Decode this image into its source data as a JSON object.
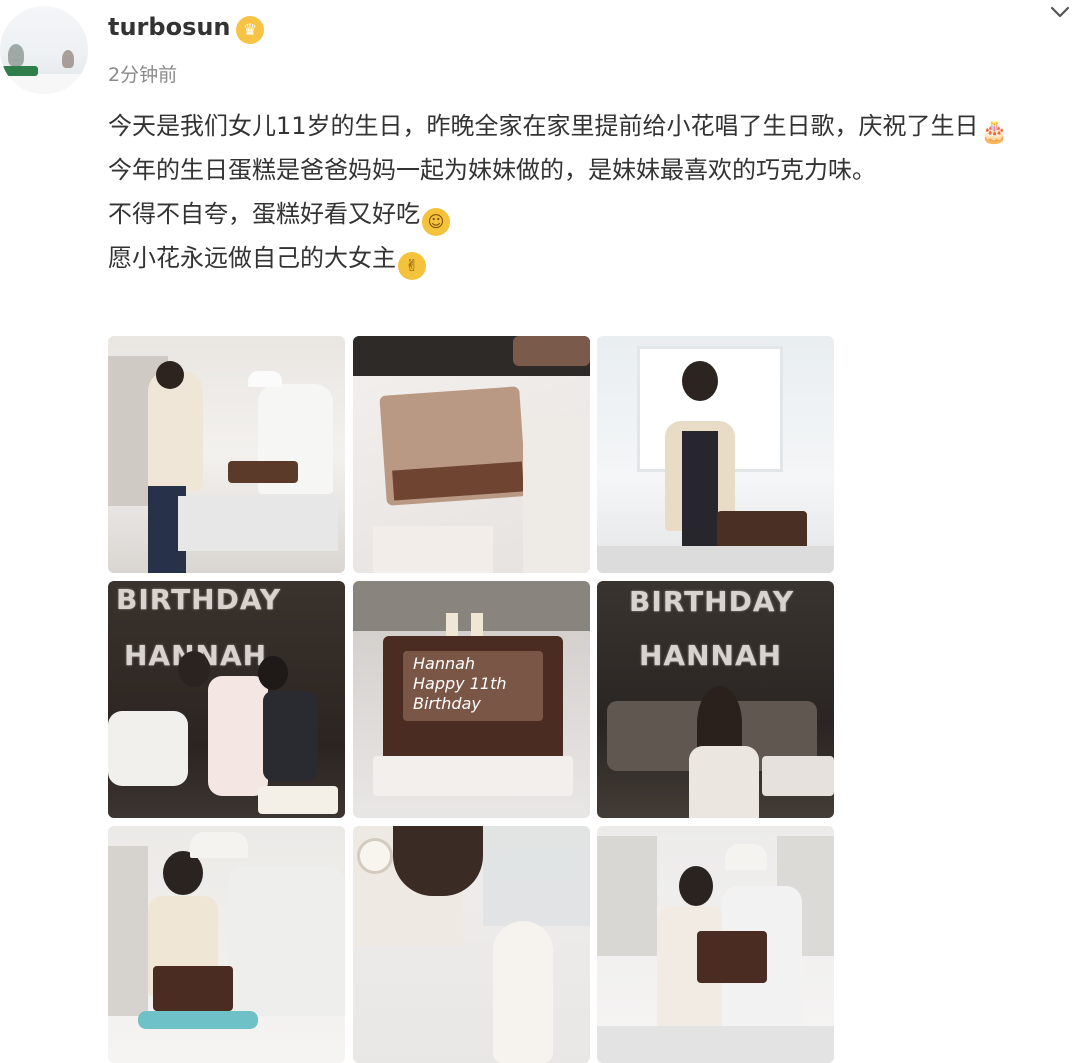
{
  "post": {
    "username": "turbosun",
    "time": "2分钟前",
    "lines": [
      "今天是我们女儿11岁的生日，昨晚全家在家里提前给小花唱了生日歌，庆祝了生日",
      "今年的生日蛋糕是爸爸妈妈一起为妹妹做的，是妹妹最喜欢的巧克力味。",
      "不得不自夸，蛋糕好看又好吃",
      "愿小花永远做自己的大女主"
    ],
    "icons": {
      "badge": "crown-badge-icon",
      "menu": "chevron-down-icon",
      "line1": "birthday-cake-icon",
      "line3": "proud-face-icon",
      "line4": "victory-hand-icon"
    }
  },
  "photos": [
    {
      "name": "baking-couple-photo"
    },
    {
      "name": "frosting-cake-photo"
    },
    {
      "name": "girl-with-cake-photo"
    },
    {
      "name": "birthday-kiss-photo",
      "banner_top": "BIRTHDAY",
      "banner_bottom": "HANNAH"
    },
    {
      "name": "birthday-cake-photo",
      "cake_text": [
        "Hannah",
        "Happy 11th",
        "Birthday"
      ]
    },
    {
      "name": "birthday-girl-photo",
      "banner_top": "BIRTHDAY",
      "banner_bottom": "HANNAH"
    },
    {
      "name": "decorating-cake-photo"
    },
    {
      "name": "piping-bag-photo"
    },
    {
      "name": "family-with-cake-photo"
    }
  ]
}
